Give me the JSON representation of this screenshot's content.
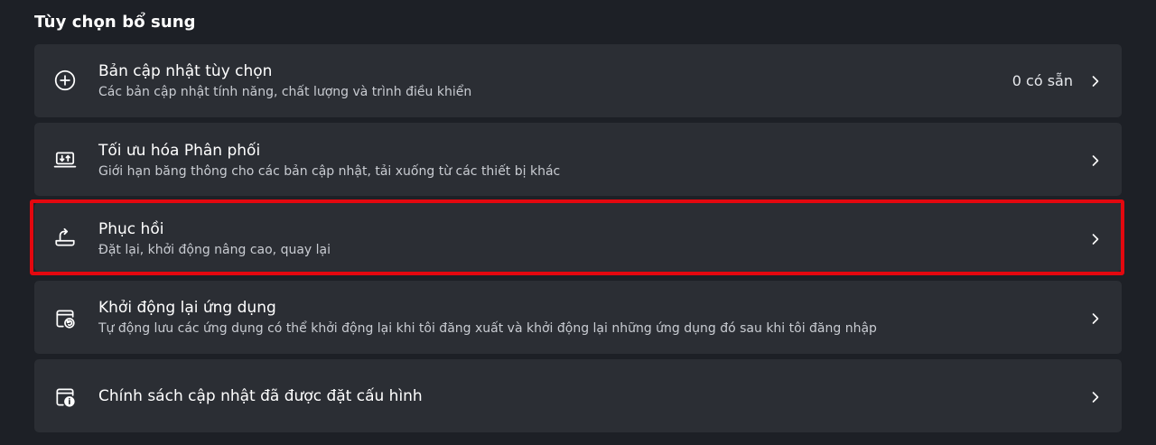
{
  "section": {
    "title": "Tùy chọn bổ sung"
  },
  "items": [
    {
      "id": "optional-updates",
      "icon": "plus-circle-icon",
      "title": "Bản cập nhật tùy chọn",
      "subtitle": "Các bản cập nhật tính năng, chất lượng và trình điều khiển",
      "value": "0 có sẵn"
    },
    {
      "id": "delivery-optimization",
      "icon": "delivery-optimization-icon",
      "title": "Tối ưu hóa Phân phối",
      "subtitle": "Giới hạn băng thông cho các bản cập nhật, tải xuống từ các thiết bị khác"
    },
    {
      "id": "recovery",
      "icon": "recovery-icon",
      "title": "Phục hồi",
      "subtitle": "Đặt lại, khởi động nâng cao, quay lại"
    },
    {
      "id": "restart-apps",
      "icon": "restart-apps-icon",
      "title": "Khởi động lại ứng dụng",
      "subtitle": "Tự động lưu các ứng dụng có thể khởi động lại khi tôi đăng xuất và khởi động lại những ứng dụng đó sau khi tôi đăng nhập"
    },
    {
      "id": "configured-update-policies",
      "icon": "policy-info-icon",
      "title": "Chính sách cập nhật đã được đặt cấu hình"
    }
  ],
  "colors": {
    "background": "#1d2026",
    "card": "#2b2e34",
    "highlight": "#e3080f"
  }
}
